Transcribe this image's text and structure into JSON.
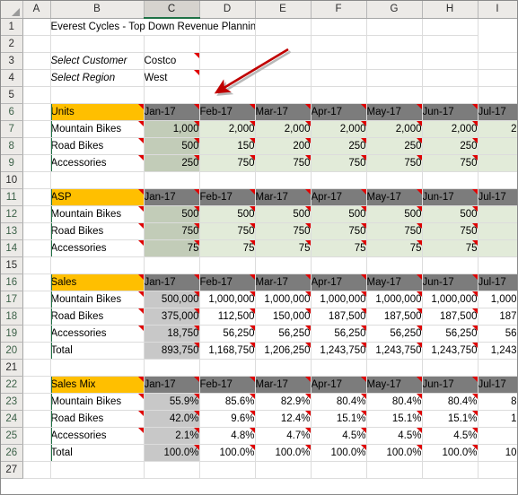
{
  "sheet": {
    "title": "Everest Cycles - Top Down Revenue Planning",
    "selected_column": "C",
    "column_letters": [
      "A",
      "B",
      "C",
      "D",
      "E",
      "F",
      "G",
      "H",
      "I"
    ],
    "row_numbers": [
      "1",
      "2",
      "3",
      "4",
      "5",
      "6",
      "7",
      "8",
      "9",
      "10",
      "11",
      "12",
      "13",
      "14",
      "15",
      "16",
      "17",
      "18",
      "19",
      "20",
      "21",
      "22",
      "23",
      "24",
      "25",
      "26",
      "27"
    ],
    "accent_colors": {
      "title_green": "#375623",
      "section_header_amber": "#ffbf00",
      "month_header_gray": "#7c7c7c",
      "input_green": "#e2ebd9",
      "selection_green": "#217346",
      "arrow_red": "#c00000",
      "comment_red": "#e00000"
    }
  },
  "selectors": {
    "customer_label": "Select Customer",
    "customer_value": "Costco",
    "region_label": "Select Region",
    "region_value": "West"
  },
  "months": [
    "Jan-17",
    "Feb-17",
    "Mar-17",
    "Apr-17",
    "May-17",
    "Jun-17",
    "Jul-17"
  ],
  "sections": [
    {
      "name": "Units",
      "header_row": "6",
      "rows": [
        {
          "label": "Mountain Bikes",
          "values": [
            "1,000",
            "2,000",
            "2,000",
            "2,000",
            "2,000",
            "2,000",
            "2"
          ]
        },
        {
          "label": "Road Bikes",
          "values": [
            "500",
            "150",
            "200",
            "250",
            "250",
            "250",
            ""
          ]
        },
        {
          "label": "Accessories",
          "values": [
            "250",
            "750",
            "750",
            "750",
            "750",
            "750",
            ""
          ]
        }
      ],
      "total": null
    },
    {
      "name": "ASP",
      "header_row": "11",
      "rows": [
        {
          "label": "Mountain Bikes",
          "values": [
            "500",
            "500",
            "500",
            "500",
            "500",
            "500",
            ""
          ]
        },
        {
          "label": "Road Bikes",
          "values": [
            "750",
            "750",
            "750",
            "750",
            "750",
            "750",
            ""
          ]
        },
        {
          "label": "Accessories",
          "values": [
            "75",
            "75",
            "75",
            "75",
            "75",
            "75",
            ""
          ]
        }
      ],
      "total": null
    },
    {
      "name": "Sales",
      "header_row": "16",
      "rows": [
        {
          "label": "Mountain Bikes",
          "values": [
            "500,000",
            "1,000,000",
            "1,000,000",
            "1,000,000",
            "1,000,000",
            "1,000,000",
            "1,000"
          ]
        },
        {
          "label": "Road Bikes",
          "values": [
            "375,000",
            "112,500",
            "150,000",
            "187,500",
            "187,500",
            "187,500",
            "187"
          ]
        },
        {
          "label": "Accessories",
          "values": [
            "18,750",
            "56,250",
            "56,250",
            "56,250",
            "56,250",
            "56,250",
            "56"
          ]
        }
      ],
      "total": {
        "label": "Total",
        "values": [
          "893,750",
          "1,168,750",
          "1,206,250",
          "1,243,750",
          "1,243,750",
          "1,243,750",
          "1,243"
        ]
      }
    },
    {
      "name": "Sales Mix",
      "header_row": "22",
      "rows": [
        {
          "label": "Mountain Bikes",
          "values": [
            "55.9%",
            "85.6%",
            "82.9%",
            "80.4%",
            "80.4%",
            "80.4%",
            "8"
          ]
        },
        {
          "label": "Road Bikes",
          "values": [
            "42.0%",
            "9.6%",
            "12.4%",
            "15.1%",
            "15.1%",
            "15.1%",
            "1"
          ]
        },
        {
          "label": "Accessories",
          "values": [
            "2.1%",
            "4.8%",
            "4.7%",
            "4.5%",
            "4.5%",
            "4.5%",
            ""
          ]
        }
      ],
      "total": {
        "label": "Total",
        "values": [
          "100.0%",
          "100.0%",
          "100.0%",
          "100.0%",
          "100.0%",
          "100.0%",
          "10"
        ]
      }
    }
  ],
  "annotation": {
    "arrow_name": "red-pointer-arrow",
    "points_to": "Jan-17 header cell in column C"
  }
}
